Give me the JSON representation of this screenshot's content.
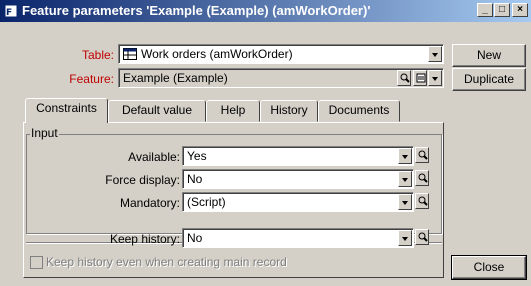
{
  "window": {
    "title": "Feature parameters 'Example (Example) (amWorkOrder)'",
    "minimize_glyph": "_",
    "maximize_glyph": "□",
    "close_glyph": "×"
  },
  "header": {
    "table_label": "Table:",
    "table_value": "Work orders (amWorkOrder)",
    "feature_label": "Feature:",
    "feature_value": "Example (Example)"
  },
  "buttons": {
    "new": "New",
    "duplicate": "Duplicate",
    "close": "Close"
  },
  "tabs": [
    {
      "label": "Constraints",
      "active": true
    },
    {
      "label": "Default value",
      "active": false
    },
    {
      "label": "Help",
      "active": false
    },
    {
      "label": "History",
      "active": false
    },
    {
      "label": "Documents",
      "active": false
    }
  ],
  "input_group": {
    "label": "Input",
    "available_label": "Available:",
    "available_value": "Yes",
    "force_display_label": "Force display:",
    "force_display_value": "No",
    "mandatory_label": "Mandatory:",
    "mandatory_value": "(Script)"
  },
  "history": {
    "keep_history_label": "Keep history:",
    "keep_history_value": "No",
    "keep_history_main_label": "Keep history even when creating main record",
    "keep_history_main_checked": false
  },
  "colors": {
    "required_label": "#c00000",
    "titlebar_start": "#0a246a",
    "titlebar_end": "#a6caf0"
  }
}
